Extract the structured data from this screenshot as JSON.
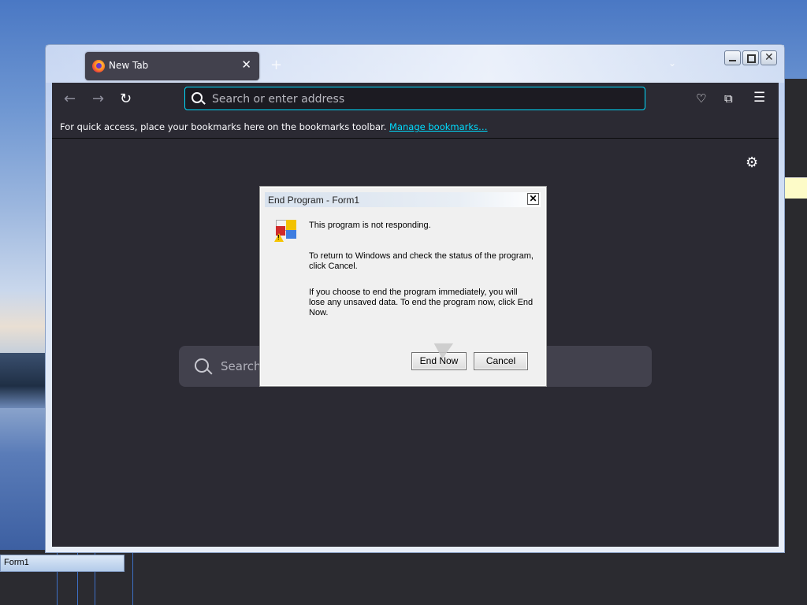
{
  "browser": {
    "tab_label": "New Tab",
    "new_tab_symbol": "+",
    "url_placeholder": "Search or enter address",
    "bookmarks_text": "For quick access, place your bookmarks here on the bookmarks toolbar.",
    "bookmarks_link": "Manage bookmarks…",
    "content_search_label": "Search"
  },
  "dialog": {
    "title": "End Program - Form1",
    "line1": "This program is not responding.",
    "line2": "To return to Windows and check the status of the program, click Cancel.",
    "line3": "If you choose to end the program immediately, you will lose any unsaved data. To end the program now, click End Now.",
    "end_now_label": "End Now",
    "cancel_label": "Cancel"
  },
  "taskbar": {
    "item_label": "Form1"
  },
  "colors": {
    "accent": "#00ddff",
    "toolbar_bg": "#2b2a33"
  }
}
